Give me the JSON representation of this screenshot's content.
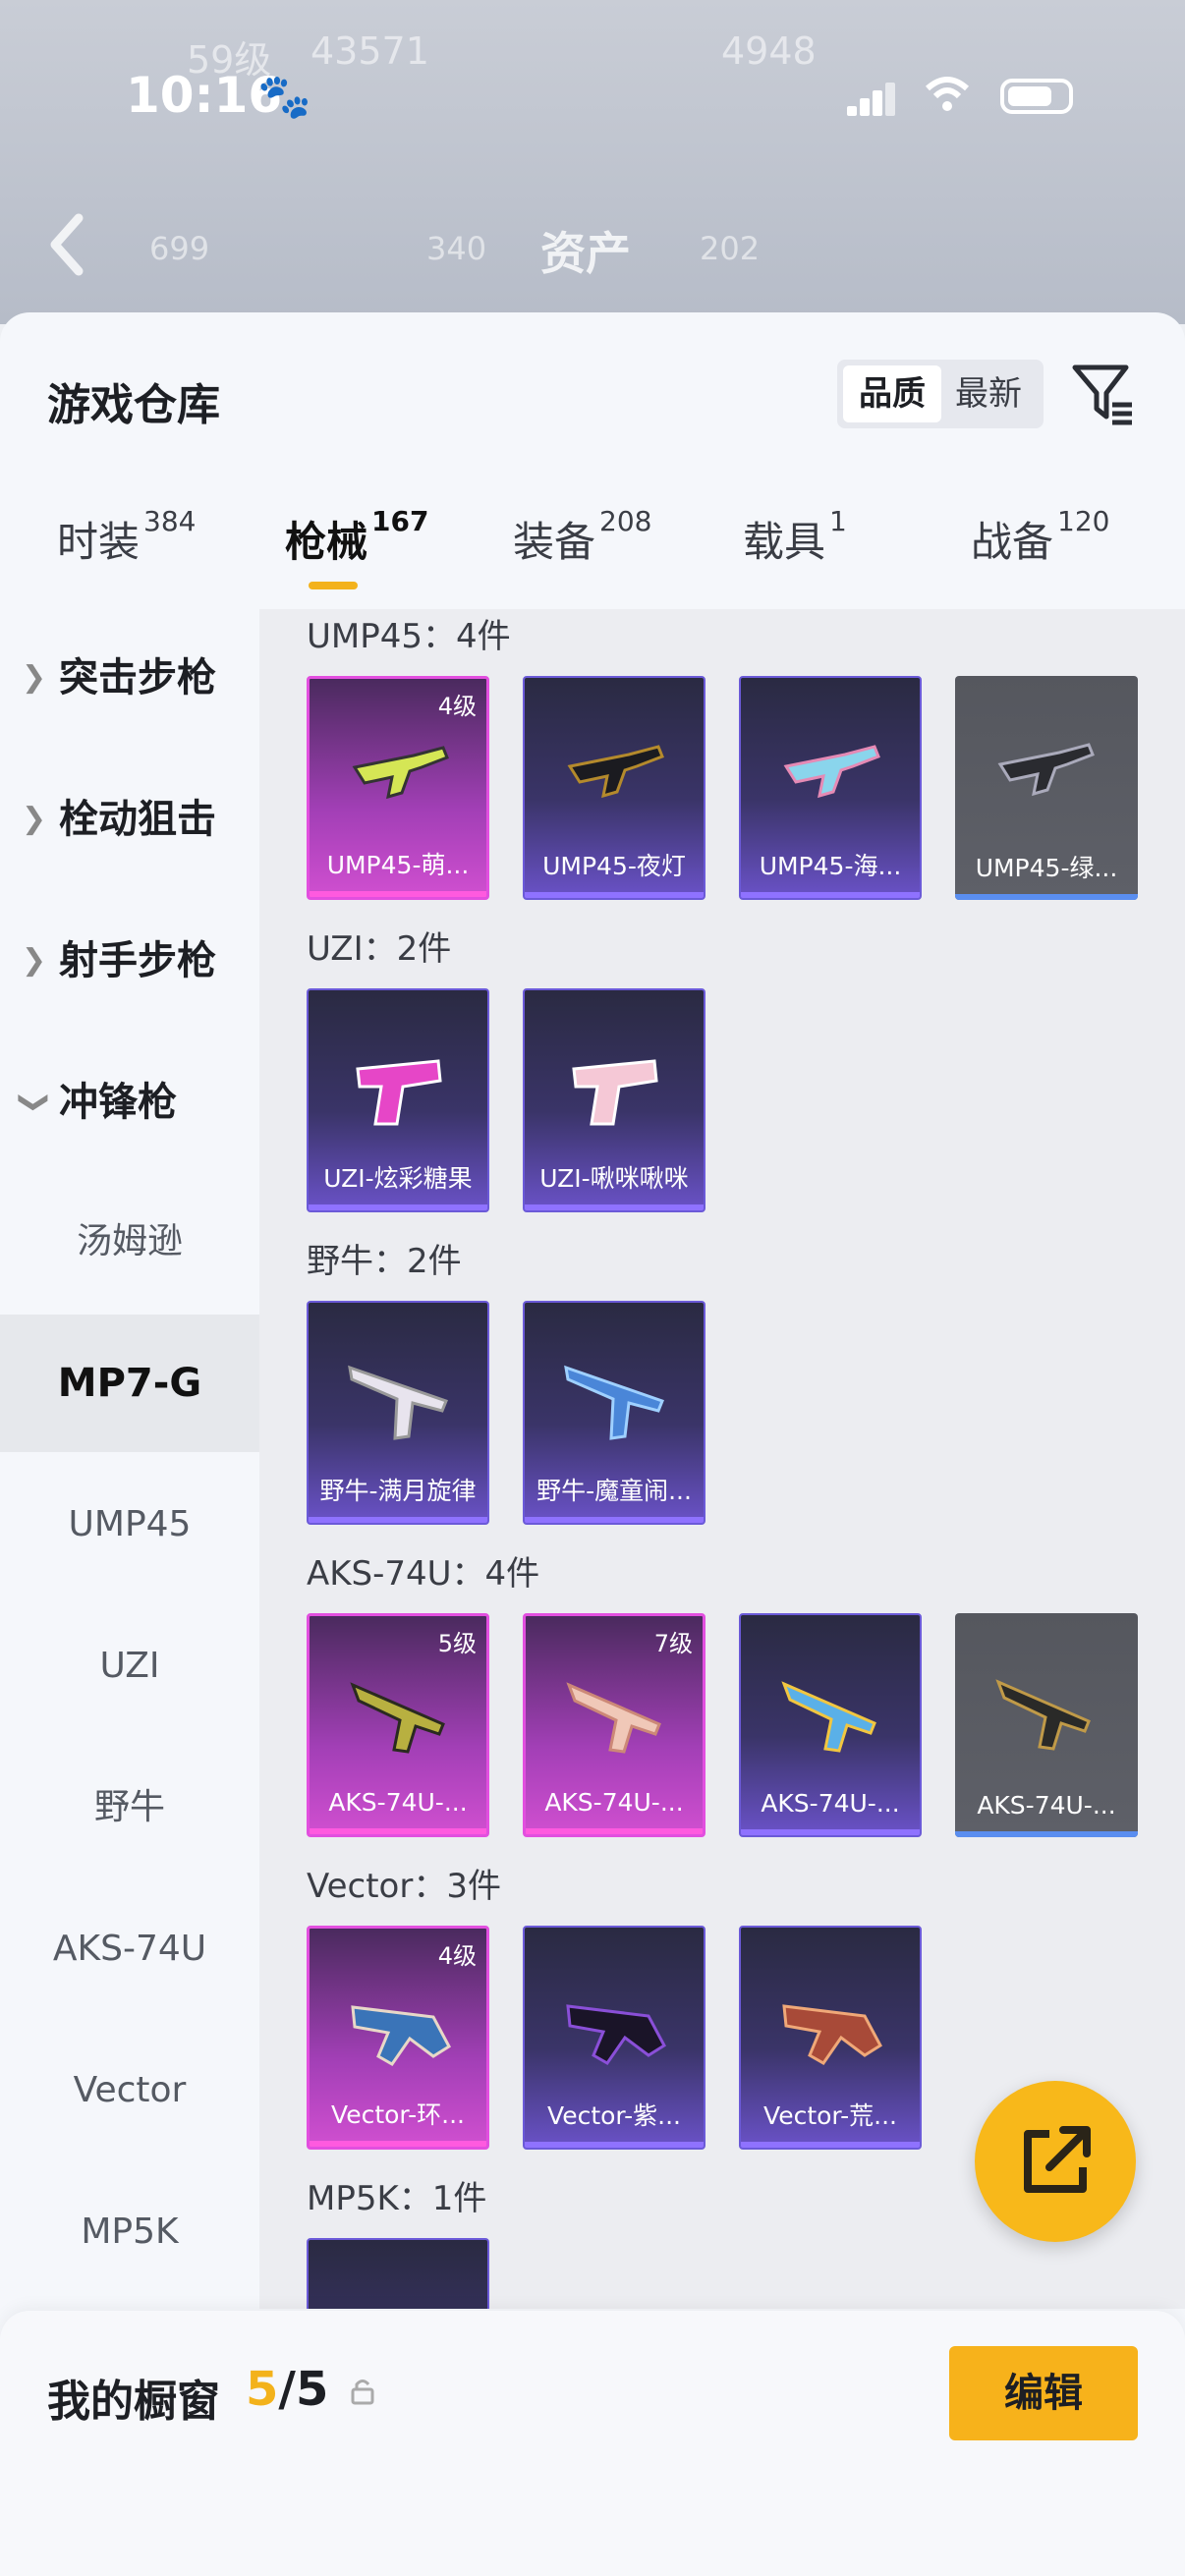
{
  "status_bar": {
    "time": "10:16",
    "time_icon": "paw-icon"
  },
  "header": {
    "ghost_level": "59级",
    "ghost_score": "43571",
    "ghost_rank": "4948",
    "ghost_stat1": "699",
    "ghost_stat2": "340",
    "ghost_stat3": "202",
    "title": "资产"
  },
  "sheet": {
    "title": "游戏仓库",
    "sort": {
      "options": [
        "品质",
        "最新"
      ],
      "selected": "品质"
    },
    "tabs": [
      {
        "label": "时装",
        "count": "384"
      },
      {
        "label": "枪械",
        "count": "167"
      },
      {
        "label": "装备",
        "count": "208"
      },
      {
        "label": "载具",
        "count": "1"
      },
      {
        "label": "战备",
        "count": "120"
      }
    ],
    "active_tab": "枪械"
  },
  "sidebar": {
    "categories": [
      {
        "label": "突击步枪",
        "expanded": false
      },
      {
        "label": "栓动狙击",
        "expanded": false
      },
      {
        "label": "射手步枪",
        "expanded": false
      },
      {
        "label": "冲锋枪",
        "expanded": true
      }
    ],
    "subitems": [
      "汤姆逊",
      "MP7-G",
      "UMP45",
      "UZI",
      "野牛",
      "AKS-74U",
      "Vector",
      "MP5K"
    ],
    "selected_subitem": "MP7-G"
  },
  "groups": [
    {
      "title": "UMP45：4件",
      "items": [
        {
          "name": "UMP45-萌...",
          "level": "4级",
          "rarity": "pink"
        },
        {
          "name": "UMP45-夜灯",
          "level": "",
          "rarity": "purple"
        },
        {
          "name": "UMP45-海...",
          "level": "",
          "rarity": "purple"
        },
        {
          "name": "UMP45-绿...",
          "level": "",
          "rarity": "gray"
        }
      ]
    },
    {
      "title": "UZI：2件",
      "items": [
        {
          "name": "UZI-炫彩糖果",
          "level": "",
          "rarity": "purple"
        },
        {
          "name": "UZI-啾咪啾咪",
          "level": "",
          "rarity": "purple"
        }
      ]
    },
    {
      "title": "野牛：2件",
      "items": [
        {
          "name": "野牛-满月旋律",
          "level": "",
          "rarity": "purple"
        },
        {
          "name": "野牛-魔童闹...",
          "level": "",
          "rarity": "purple"
        }
      ]
    },
    {
      "title": "AKS-74U：4件",
      "items": [
        {
          "name": "AKS-74U-...",
          "level": "5级",
          "rarity": "pink"
        },
        {
          "name": "AKS-74U-...",
          "level": "7级",
          "rarity": "pink"
        },
        {
          "name": "AKS-74U-...",
          "level": "",
          "rarity": "purple"
        },
        {
          "name": "AKS-74U-...",
          "level": "",
          "rarity": "gray"
        }
      ]
    },
    {
      "title": "Vector：3件",
      "items": [
        {
          "name": "Vector-环...",
          "level": "4级",
          "rarity": "pink"
        },
        {
          "name": "Vector-紫...",
          "level": "",
          "rarity": "purple"
        },
        {
          "name": "Vector-荒...",
          "level": "",
          "rarity": "purple"
        }
      ]
    },
    {
      "title": "MP5K：1件",
      "items": [
        {
          "name": "",
          "level": "",
          "rarity": "purple"
        }
      ]
    }
  ],
  "fab": {
    "icon": "share-icon"
  },
  "bottom": {
    "label": "我的橱窗",
    "current": "5",
    "separator": "/",
    "total": "5",
    "lock_icon": "lock-icon",
    "edit_label": "编辑"
  },
  "colors": {
    "accent": "#f3b21b",
    "pink_rarity": "#e24fdf",
    "purple_rarity": "#6b5ad8",
    "gray_rarity": "#5a8ef0"
  }
}
